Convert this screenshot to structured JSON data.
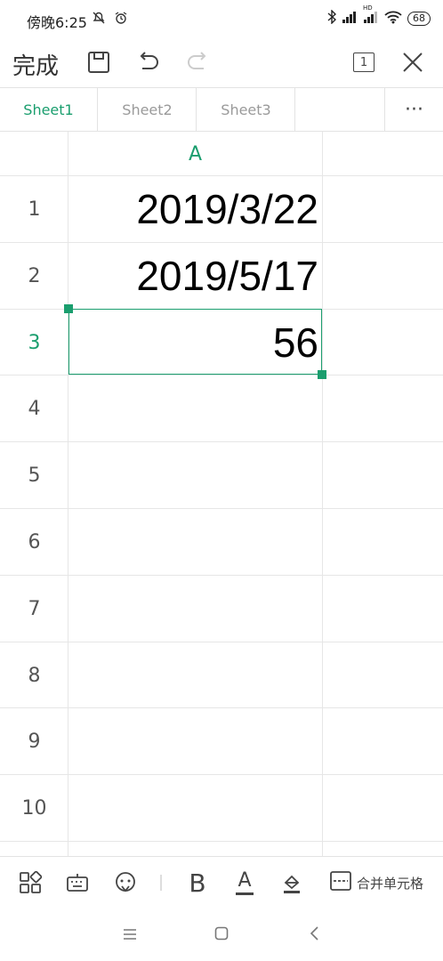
{
  "status_bar": {
    "time": "傍晚6:25",
    "battery": "68",
    "hd_label": "HD"
  },
  "toolbar": {
    "done_label": "完成",
    "window_count": "1"
  },
  "tabs": [
    {
      "label": "Sheet1",
      "active": true
    },
    {
      "label": "Sheet2",
      "active": false
    },
    {
      "label": "Sheet3",
      "active": false
    }
  ],
  "tabs_more": "···",
  "sheet": {
    "column_header": "A",
    "rows": [
      {
        "num": "1",
        "value": "2019/3/22"
      },
      {
        "num": "2",
        "value": "2019/5/17"
      },
      {
        "num": "3",
        "value": "56",
        "selected": true
      },
      {
        "num": "4",
        "value": ""
      },
      {
        "num": "5",
        "value": ""
      },
      {
        "num": "6",
        "value": ""
      },
      {
        "num": "7",
        "value": ""
      },
      {
        "num": "8",
        "value": ""
      },
      {
        "num": "9",
        "value": ""
      },
      {
        "num": "10",
        "value": ""
      }
    ]
  },
  "bottom_tools": {
    "bold_label": "B",
    "font_color_label": "A",
    "merge_label": "合并单元格"
  },
  "colors": {
    "accent": "#1a9e6e",
    "grid_line": "#e6e6e6"
  }
}
